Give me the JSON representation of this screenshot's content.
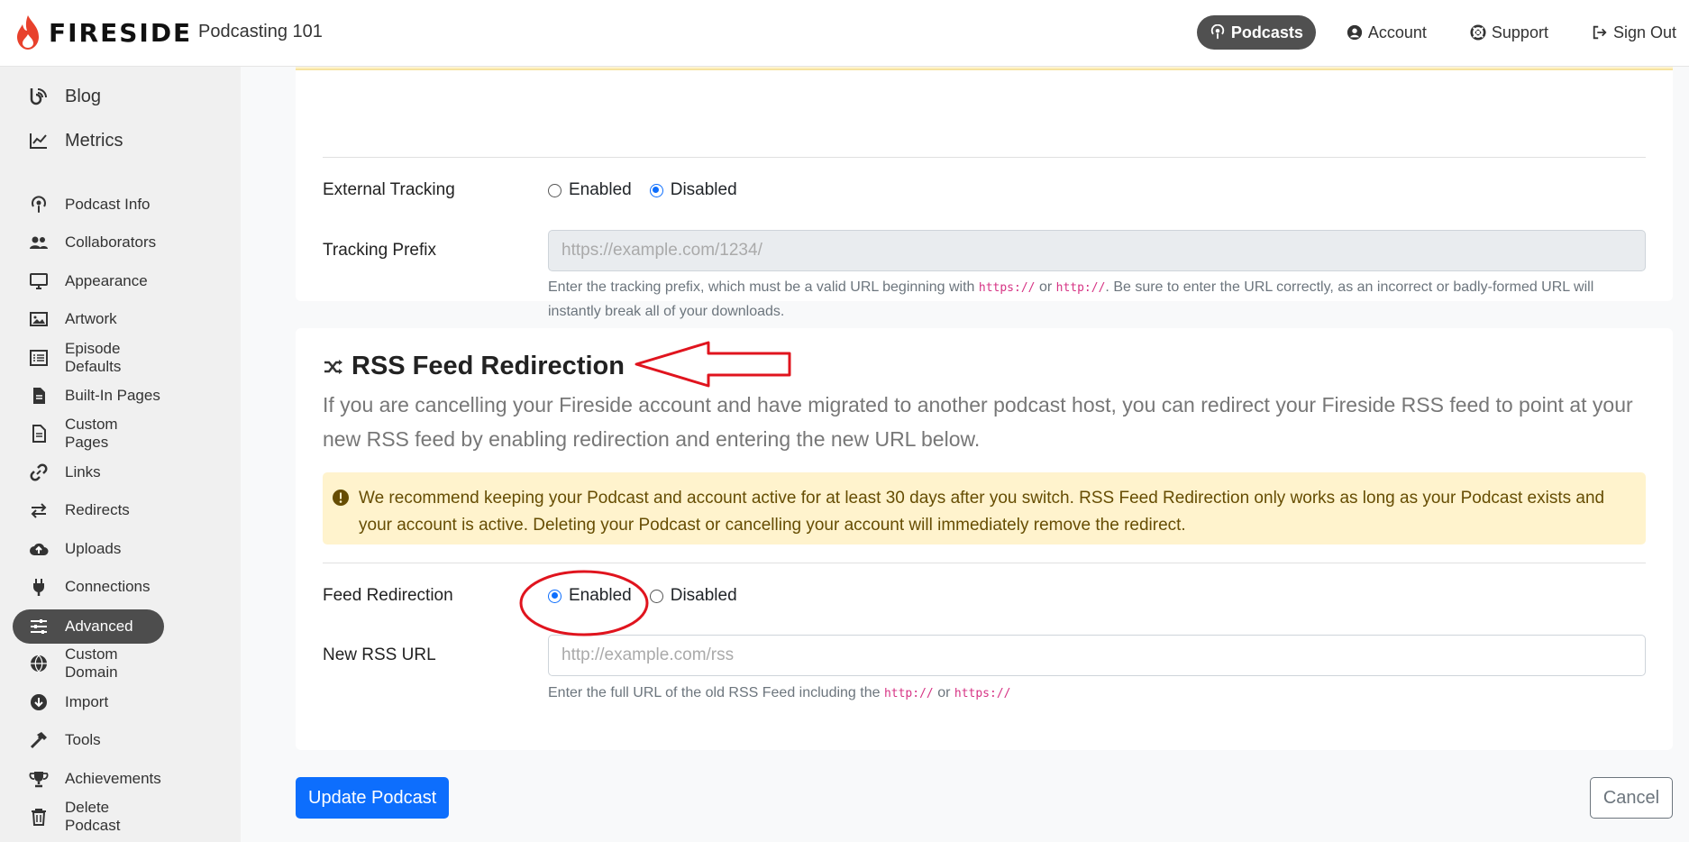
{
  "header": {
    "brand": "FIRESIDE",
    "podcast_name": "Podcasting 101",
    "nav": [
      {
        "label": "Podcasts",
        "icon": "podcast-icon",
        "active": true
      },
      {
        "label": "Account",
        "icon": "user-circle-icon"
      },
      {
        "label": "Support",
        "icon": "lifebuoy-icon"
      },
      {
        "label": "Sign Out",
        "icon": "sign-out-icon"
      }
    ]
  },
  "sidebar": {
    "items": [
      {
        "label": "Blog",
        "icon": "blog-icon"
      },
      {
        "label": "Metrics",
        "icon": "chart-line-icon"
      },
      {
        "label": "Podcast Info",
        "icon": "podcast-icon"
      },
      {
        "label": "Collaborators",
        "icon": "users-icon"
      },
      {
        "label": "Appearance",
        "icon": "desktop-icon"
      },
      {
        "label": "Artwork",
        "icon": "image-icon"
      },
      {
        "label": "Episode Defaults",
        "icon": "list-icon"
      },
      {
        "label": "Built-In Pages",
        "icon": "file-icon"
      },
      {
        "label": "Custom Pages",
        "icon": "file-outline-icon"
      },
      {
        "label": "Links",
        "icon": "link-icon"
      },
      {
        "label": "Redirects",
        "icon": "exchange-icon"
      },
      {
        "label": "Uploads",
        "icon": "cloud-upload-icon"
      },
      {
        "label": "Connections",
        "icon": "plug-icon"
      },
      {
        "label": "Advanced",
        "icon": "sliders-icon",
        "active": true
      },
      {
        "label": "Custom Domain",
        "icon": "globe-icon"
      },
      {
        "label": "Import",
        "icon": "download-circle-icon"
      },
      {
        "label": "Tools",
        "icon": "hammer-icon"
      },
      {
        "label": "Achievements",
        "icon": "trophy-icon"
      },
      {
        "label": "Delete Podcast",
        "icon": "trash-icon"
      }
    ]
  },
  "tracking": {
    "external_label": "External Tracking",
    "enabled_label": "Enabled",
    "disabled_label": "Disabled",
    "selected": "Disabled",
    "prefix_label": "Tracking Prefix",
    "prefix_placeholder": "https://example.com/1234/",
    "help_before": "Enter the tracking prefix, which must be a valid URL beginning with ",
    "help_code1": "https://",
    "help_or": " or ",
    "help_code2": "http://",
    "help_after": ". Be sure to enter the URL correctly, as an incorrect or badly-formed URL will instantly break all of your downloads."
  },
  "rss": {
    "title": "RSS Feed Redirection",
    "lead": "If you are cancelling your Fireside account and have migrated to another podcast host, you can redirect your Fireside RSS feed to point at your new RSS feed by enabling redirection and entering the new URL below.",
    "alert": "We recommend keeping your Podcast and account active for at least 30 days after you switch. RSS Feed Redirection only works as long as your Podcast exists and your account is active. Deleting your Podcast or cancelling your account will immediately remove the redirect.",
    "feed_label": "Feed Redirection",
    "enabled_label": "Enabled",
    "disabled_label": "Disabled",
    "selected": "Enabled",
    "url_label": "New RSS URL",
    "url_placeholder": "http://example.com/rss",
    "help_before": "Enter the full URL of the old RSS Feed including the ",
    "help_code1": "http://",
    "help_or": " or ",
    "help_code2": "https://"
  },
  "actions": {
    "update_label": "Update Podcast",
    "cancel_label": "Cancel"
  },
  "colors": {
    "primary": "#0d6efd",
    "annotation": "#e0141e",
    "warning_bg": "#fff3cd",
    "brand_flame": "#e8412c"
  }
}
